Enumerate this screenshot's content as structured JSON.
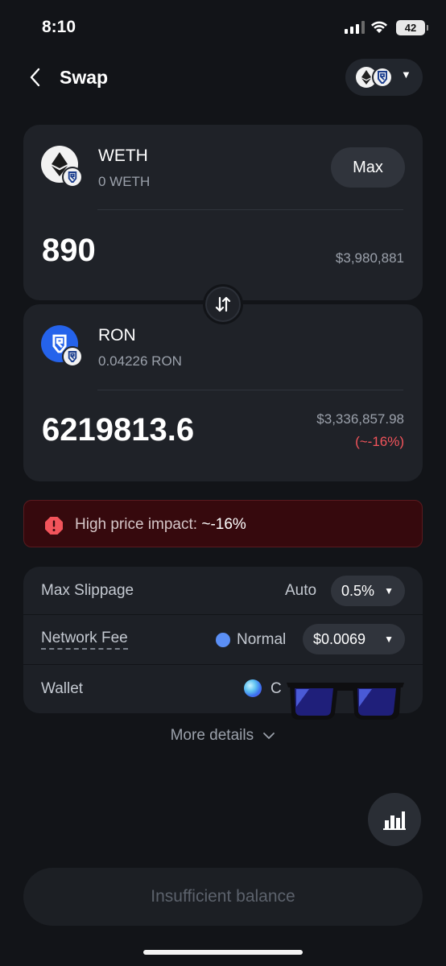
{
  "status_bar": {
    "time": "8:10",
    "battery": "42"
  },
  "header": {
    "title": "Swap",
    "network_icons": [
      "ethereum-icon",
      "ronin-icon"
    ]
  },
  "from_token": {
    "symbol": "WETH",
    "balance": "0 WETH",
    "max_label": "Max",
    "amount": "890",
    "usd_value": "$3,980,881",
    "icon": "ethereum-icon"
  },
  "to_token": {
    "symbol": "RON",
    "balance": "0.04226 RON",
    "amount": "6219813.6",
    "usd_value": "$3,336,857.98",
    "price_impact": "(~-16%)",
    "icon": "ronin-icon"
  },
  "warning": {
    "label": "High price impact:",
    "value": "~-16%"
  },
  "settings": {
    "max_slippage": {
      "label": "Max Slippage",
      "mode": "Auto",
      "value": "0.5%"
    },
    "network_fee": {
      "label": "Network Fee",
      "speed": "Normal",
      "value": "$0.0069"
    },
    "wallet": {
      "label": "Wallet",
      "value_visible": "C"
    }
  },
  "more_details": "More details",
  "cta_label": "Insufficient balance",
  "colors": {
    "background": "#121418",
    "card": "#1f2228",
    "danger": "#f2545b",
    "warning_bg": "#36090d",
    "ronin_blue": "#2563eb"
  }
}
